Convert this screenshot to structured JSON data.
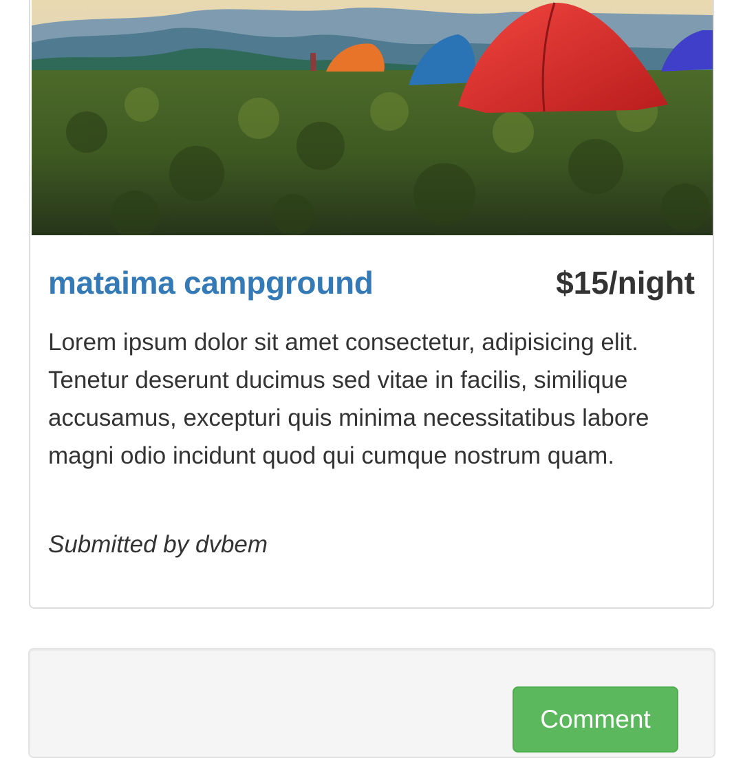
{
  "campground": {
    "image_alt": "tents on a grassy hillside",
    "name": "mataima campground",
    "price": "$15/night",
    "description": "Lorem ipsum dolor sit amet consectetur, adipisicing elit. Tenetur deserunt ducimus sed vitae in facilis, similique accusamus, excepturi quis minima necessitatibus labore magni odio incidunt quod qui cumque nostrum quam.",
    "submitted_by": "Submitted by dvbem"
  },
  "comments": {
    "button_label": "Comment"
  },
  "colors": {
    "title_link": "#337ab7",
    "button_success": "#5cb85c",
    "well_background": "#f5f5f5"
  }
}
